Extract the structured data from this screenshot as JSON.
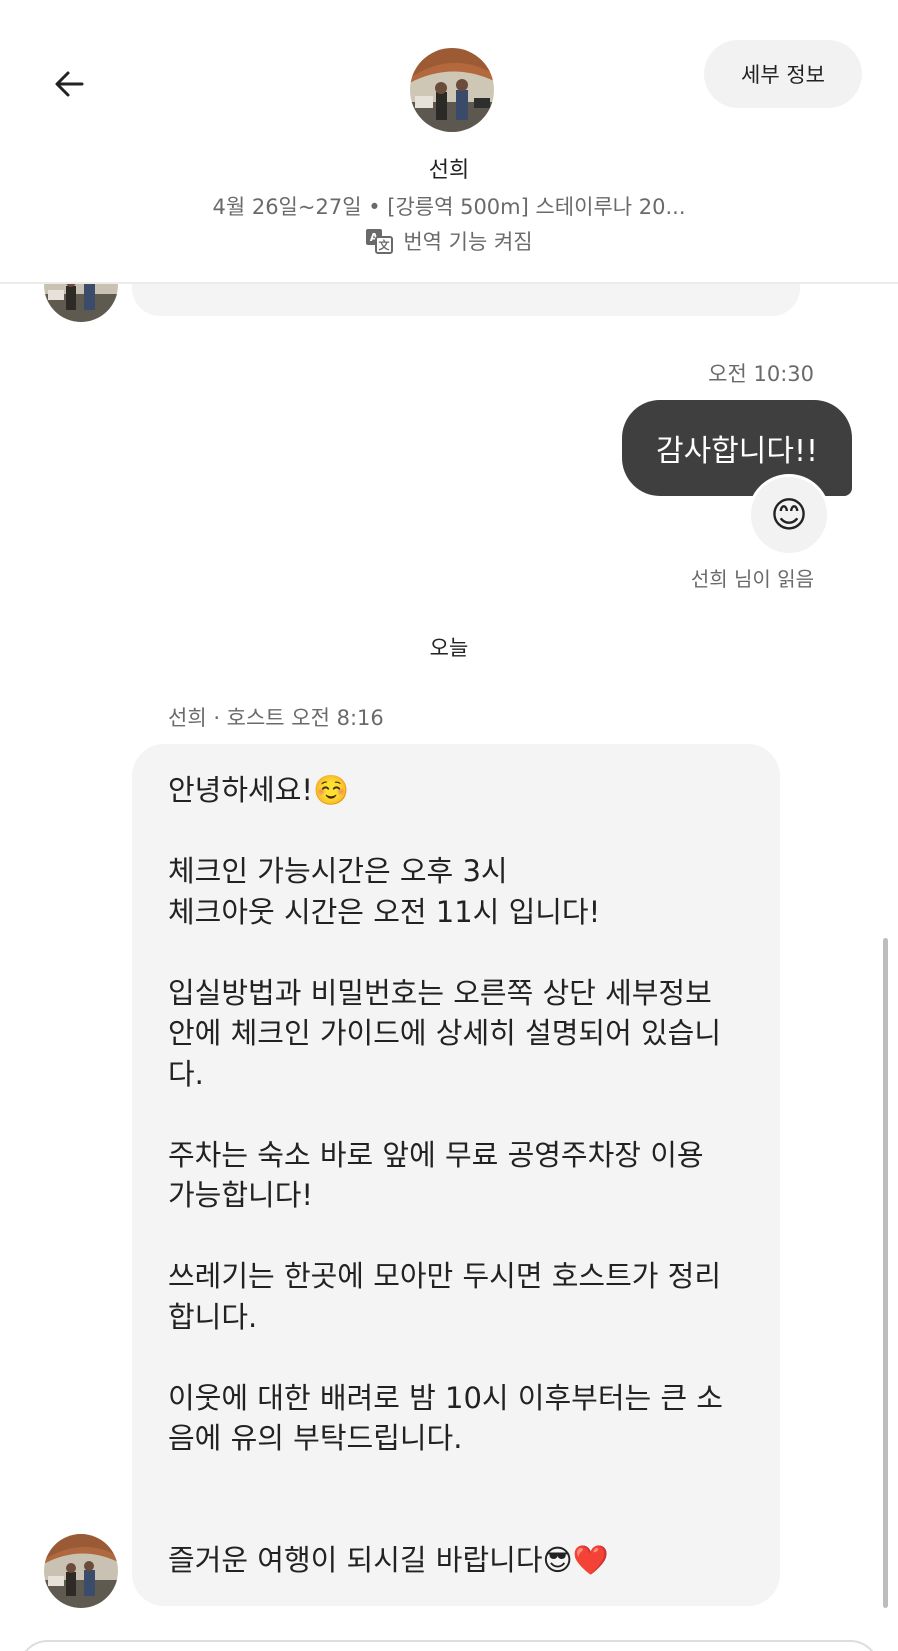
{
  "header": {
    "back_label": "←",
    "details_label": "세부 정보",
    "host_name": "선희",
    "subtitle": "4월 26일~27일 • [강릉역 500m] 스테이루나 20...",
    "translate_label": "번역 기능 켜짐"
  },
  "messages": {
    "my_time": "오전 10:30",
    "my_text": "감사합니다!!",
    "reaction_emoji": "😊",
    "read_status": "선희 님이 읽음",
    "day_separator": "오늘",
    "host_meta": "선희 · 호스트 오전 8:16",
    "host_lines": [
      "안녕하세요!☺️",
      "",
      "체크인 가능시간은 오후 3시",
      "체크아웃 시간은 오전 11시 입니다!",
      "",
      "입실방법과 비밀번호는 오른쪽 상단 세부정보",
      "안에 체크인 가이드에 상세히 설명되어 있습니",
      "다.",
      "",
      "주차는 숙소 바로 앞에 무료 공영주차장 이용",
      "가능합니다!",
      "",
      "쓰레기는 한곳에 모아만 두시면 호스트가 정리",
      "합니다.",
      "",
      "이웃에 대한 배려로 밤 10시 이후부터는 큰 소",
      "음에 유의 부탁드립니다.",
      "",
      "",
      "즐거운 여행이 되시길 바랍니다😎❤️"
    ]
  },
  "icons": {
    "back": "arrow-left-icon",
    "translate": "translate-icon",
    "avatar": "host-avatar-photo"
  },
  "colors": {
    "my_bubble": "#3f3f3f",
    "host_bubble": "#f4f4f4",
    "muted_text": "#6a6a6a",
    "pill": "#f2f2f2"
  }
}
